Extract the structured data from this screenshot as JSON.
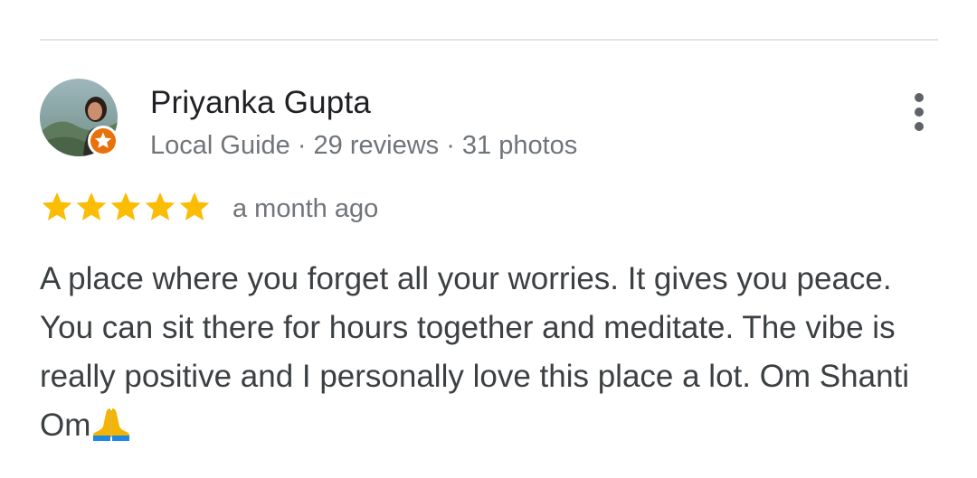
{
  "review": {
    "author_name": "Priyanka Gupta",
    "author_meta": "Local Guide · 29 reviews · 31 photos",
    "rating": 5,
    "rating_max": 5,
    "time_ago": "a month ago",
    "text": "A place where you forget all your worries. It gives you peace. You can sit there for hours together and meditate. The vibe is really positive and I personally love this place a lot. Om Shanti Om",
    "text_emoji": "folded-hands-emoji"
  },
  "icons": {
    "avatar": "user-avatar-photo",
    "local_guide_badge": "local-guide-star-badge-icon",
    "more_menu": "more-vert-icon",
    "star": "star-icon"
  },
  "colors": {
    "star": "#fbbc04",
    "badge": "#e8710a",
    "name": "#202124",
    "secondary": "#70757a",
    "body": "#3c4043",
    "divider": "#e3e3e3"
  }
}
